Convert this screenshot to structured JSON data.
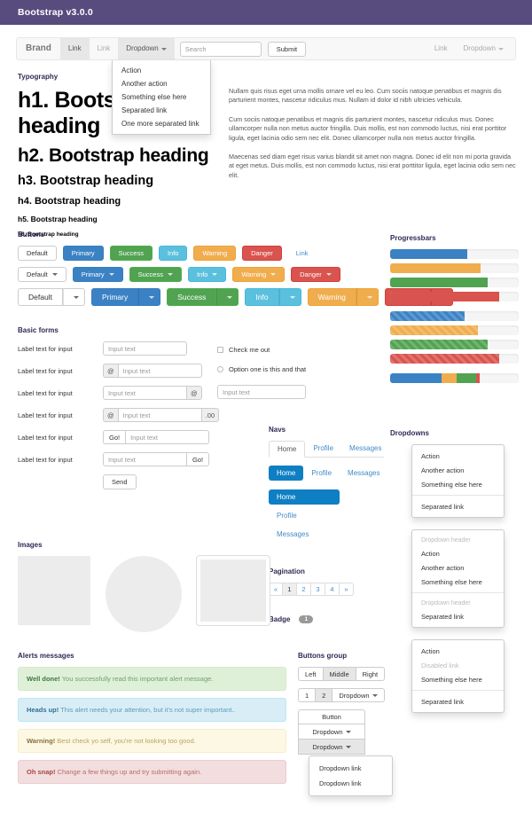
{
  "topbar": {
    "title": "Bootstrap  v3.0.0",
    "bg": "#584c7e"
  },
  "navbar": {
    "brand": "Brand",
    "link1": "Link",
    "link2": "Link",
    "dropdown": "Dropdown",
    "search_placeholder": "Search",
    "submit": "Submit",
    "right_link": "Link",
    "right_dropdown": "Dropdown",
    "menu": [
      "Action",
      "Another action",
      "Something else here",
      "Separated link",
      "One more separated link"
    ]
  },
  "typography": {
    "title": "Typography",
    "h1": "h1. Bootstrap heading",
    "h2": "h2. Bootstrap heading",
    "h3": "h3. Bootstrap heading",
    "h4": "h4. Bootstrap heading",
    "h5": "h5. Bootstrap heading",
    "h6": "h6. Bootstrap heading",
    "p1": "Nullam quis risus eget urna mollis ornare vel eu leo. Cum sociis natoque penatibus et magnis dis parturient montes, nascetur ridiculus mus. Nullam id dolor id nibh ultricies vehicula.",
    "p2": "Cum sociis natoque penatibus et magnis dis parturient montes, nascetur ridiculus mus. Donec ullamcorper nulla non metus auctor fringilla. Duis mollis, est non commodo luctus, nisi erat porttitor ligula, eget lacinia odio sem nec elit. Donec ullamcorper nulla non metus auctor fringilla.",
    "p3": "Maecenas sed diam eget risus varius blandit sit amet non magna. Donec id elit non mi porta gravida at eget metus. Duis mollis, est non commodo luctus, nisi erat porttitor ligula, eget lacinia odio sem nec elit."
  },
  "buttons": {
    "title": "Buttons",
    "labels": {
      "default": "Default",
      "primary": "Primary",
      "success": "Success",
      "info": "Info",
      "warning": "Warning",
      "danger": "Danger",
      "link": "Link"
    }
  },
  "forms": {
    "title": "Basic forms",
    "label": "Label text for input",
    "placeholder": "Input text",
    "addon_at": "@",
    "addon_cents": ".00",
    "go": "Go!",
    "send": "Send",
    "checkbox_label": "Check me out",
    "radio_label": "Option one is this and that"
  },
  "navs": {
    "title": "Navs",
    "items": [
      "Home",
      "Profile",
      "Messages"
    ]
  },
  "pagination": {
    "title": "Pagination",
    "items": [
      "«",
      "1",
      "2",
      "3",
      "4",
      "»"
    ],
    "active_index": 1
  },
  "badge": {
    "title": "Badge",
    "count": "1"
  },
  "progressbars": {
    "title": "Progressbars",
    "solid": [
      60,
      70,
      76,
      85
    ],
    "striped": [
      58,
      68,
      76,
      85
    ],
    "stacked": [
      40,
      12,
      15,
      3
    ]
  },
  "dropdowns": {
    "title": "Dropdowns",
    "panel1": [
      "Action",
      "Another action",
      "Something else here",
      "Separated link"
    ],
    "panel2_header1": "Dropdown header",
    "panel2_items1": [
      "Action",
      "Another action",
      "Something else here"
    ],
    "panel2_header2": "Dropdown header",
    "panel2_items2": [
      "Separated link"
    ],
    "panel3": [
      "Action",
      "Disabled link",
      "Something else here",
      "Separated link"
    ]
  },
  "images": {
    "title": "Images"
  },
  "alerts": {
    "title": "Alerts messages",
    "success_strong": "Well done!",
    "success_text": " You successfully read this important alert message.",
    "info_strong": "Heads up!",
    "info_text": " This alert needs your attention, but it's not super important..",
    "warning_strong": "Warning!",
    "warning_text": " Best check yo self, you're not looking too good.",
    "danger_strong": "Oh snap!",
    "danger_text": " Change a few things up and try submitting again."
  },
  "buttons_group": {
    "title": "Buttons group",
    "trio": [
      "Left",
      "Middle",
      "Right"
    ],
    "trio_active": 1,
    "numbered": [
      "1",
      "2"
    ],
    "numbered_active": 1,
    "dropdown": "Dropdown",
    "vertical": [
      "Button",
      "Dropdown",
      "Dropdown"
    ],
    "menu": [
      "Dropdown link",
      "Dropdown link"
    ]
  }
}
